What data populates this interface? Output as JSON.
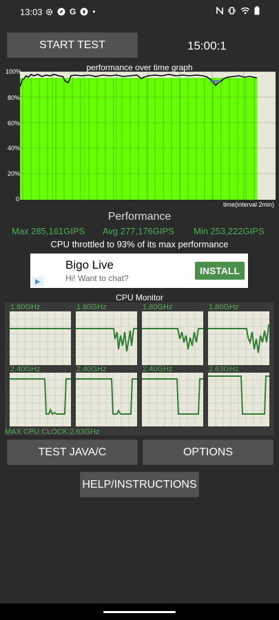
{
  "status_bar": {
    "time": "13:03",
    "g_letter": "G",
    "dot": "•"
  },
  "start_button": "START TEST",
  "timer": "15:00:1",
  "graph": {
    "title": "performance over time graph",
    "y_ticks": [
      "100%",
      "80%",
      "60%",
      "40%",
      "20%",
      "0"
    ],
    "x_label": "time(interval 2min)"
  },
  "performance": {
    "title": "Performance",
    "max": "Max 285,161GIPS",
    "avg": "Avg 277,176GIPS",
    "min": "Min 253,222GIPS",
    "throttle": "CPU throttled to 93% of its max performance"
  },
  "ad": {
    "title": "Bigo Live",
    "subtitle": "Hi! Want to chat?",
    "install": "INSTALL"
  },
  "cpu_monitor": {
    "title": "CPU Monitor",
    "cores": [
      {
        "freq": "1.80GHz"
      },
      {
        "freq": "1.80GHz"
      },
      {
        "freq": "1.80GHz"
      },
      {
        "freq": "1.80GHz"
      },
      {
        "freq": "2.40GHz"
      },
      {
        "freq": "2.40GHz"
      },
      {
        "freq": "2.40GHz"
      },
      {
        "freq": "2.63GHz"
      }
    ],
    "max_clock": "MAX CPU CLOCK:2.63GHz"
  },
  "buttons": {
    "test_java": "TEST JAVA/C",
    "options": "OPTIONS",
    "help": "HELP/INSTRUCTIONS"
  },
  "colors": {
    "accent_green": "#4caf50",
    "graph_green": "#66ff00",
    "button": "#525252"
  }
}
